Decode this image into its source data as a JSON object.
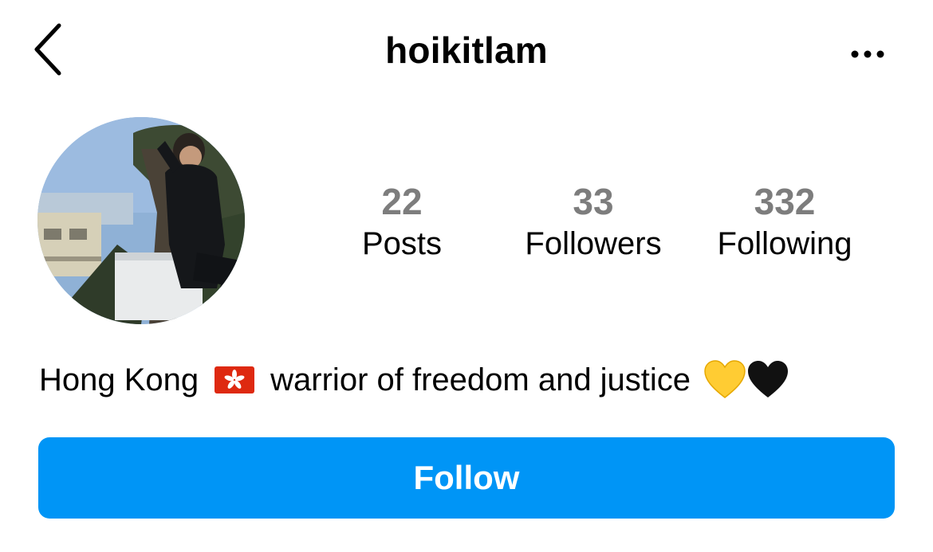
{
  "header": {
    "username": "hoikitlam",
    "back_icon": "chevron-left-icon",
    "more_icon": "ellipsis-icon"
  },
  "profile": {
    "avatar_icon": "profile-photo",
    "stats": [
      {
        "count": "22",
        "label": "Posts"
      },
      {
        "count": "33",
        "label": "Followers"
      },
      {
        "count": "332",
        "label": "Following"
      }
    ],
    "bio": {
      "part1": "Hong Kong",
      "flag": "hong-kong-flag-emoji",
      "part2": "warrior of freedom and justice",
      "emoji": [
        "yellow-heart-emoji",
        "black-heart-emoji"
      ]
    }
  },
  "actions": {
    "follow_label": "Follow"
  },
  "colors": {
    "accent": "#0095f6",
    "stat_count": "#7d7d7d",
    "flag_red": "#de2910",
    "heart_yellow": "#ffcc33",
    "heart_black": "#111111"
  }
}
